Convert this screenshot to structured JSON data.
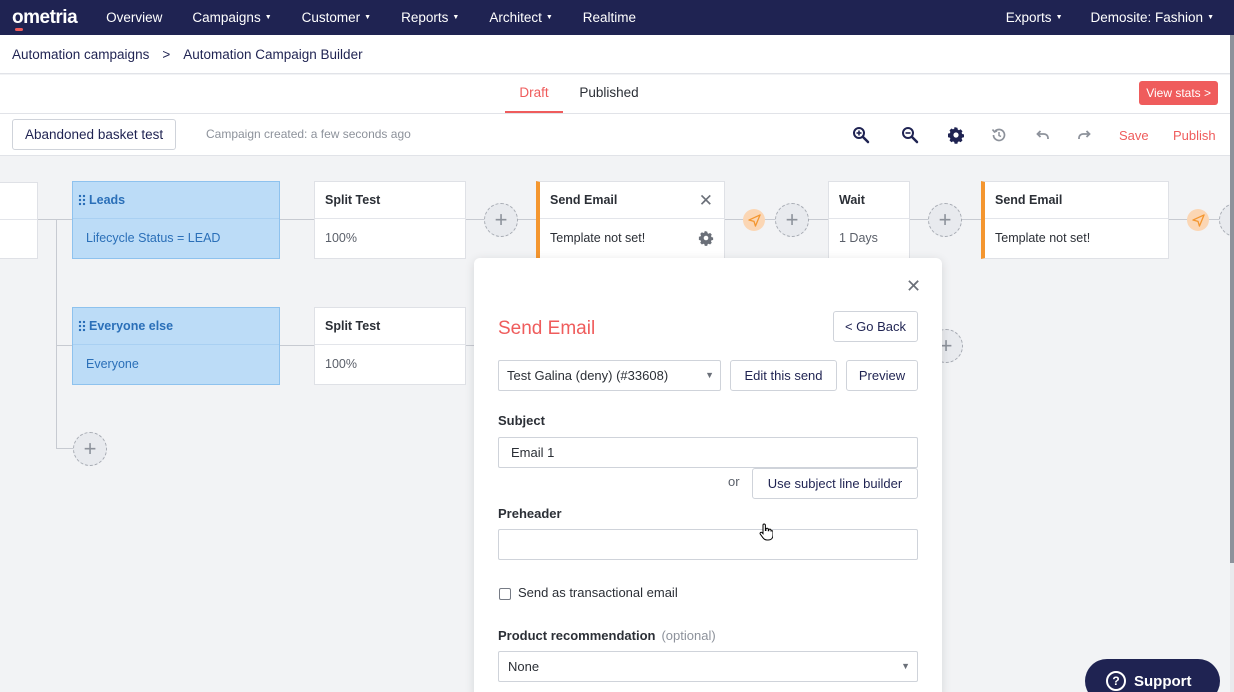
{
  "nav": {
    "logo": "ometria",
    "items": [
      "Overview",
      "Campaigns",
      "Customer",
      "Reports",
      "Architect",
      "Realtime"
    ],
    "right": [
      "Exports",
      "Demosite: Fashion"
    ]
  },
  "breadcrumb": {
    "parent": "Automation campaigns",
    "sep": ">",
    "current": "Automation Campaign Builder"
  },
  "tabs": {
    "draft": "Draft",
    "published": "Published",
    "view_stats": "View stats >"
  },
  "toolbar": {
    "campaign_name": "Abandoned basket test",
    "created": "Campaign created: a few seconds ago",
    "save": "Save",
    "publish": "Publish"
  },
  "canvas": {
    "leads": {
      "title": "Leads",
      "body": "Lifecycle Status = LEAD"
    },
    "everyone": {
      "title": "Everyone else",
      "body": "Everyone"
    },
    "split1": {
      "title": "Split Test",
      "body": "100%"
    },
    "split2": {
      "title": "Split Test",
      "body": "100%"
    },
    "email1": {
      "title": "Send Email",
      "body": "Template not set!"
    },
    "wait": {
      "title": "Wait",
      "body": "1 Days"
    },
    "email2": {
      "title": "Send Email",
      "body": "Template not set!"
    }
  },
  "modal": {
    "title": "Send Email",
    "go_back": "< Go Back",
    "send_select": "Test Galina (deny) (#33608)",
    "edit_send": "Edit this send",
    "preview": "Preview",
    "subject_label": "Subject",
    "subject_value": "Email 1",
    "or": "or",
    "subject_builder": "Use subject line builder",
    "preheader_label": "Preheader",
    "preheader_value": "",
    "transactional_label": "Send as transactional email",
    "transactional_checked": false,
    "product_label": "Product recommendation",
    "product_optional": "(optional)",
    "product_value": "None"
  },
  "support": {
    "label": "Support"
  },
  "colors": {
    "brand_navy": "#1f2352",
    "accent": "#ef5c5c",
    "segment_blue": "#bcdcf7",
    "email_orange": "#f4962f"
  },
  "icons": [
    "zoom-in-icon",
    "zoom-out-icon",
    "gear-icon",
    "history-icon",
    "undo-icon",
    "redo-icon",
    "send-icon",
    "close-icon",
    "plus-icon",
    "help-icon"
  ]
}
